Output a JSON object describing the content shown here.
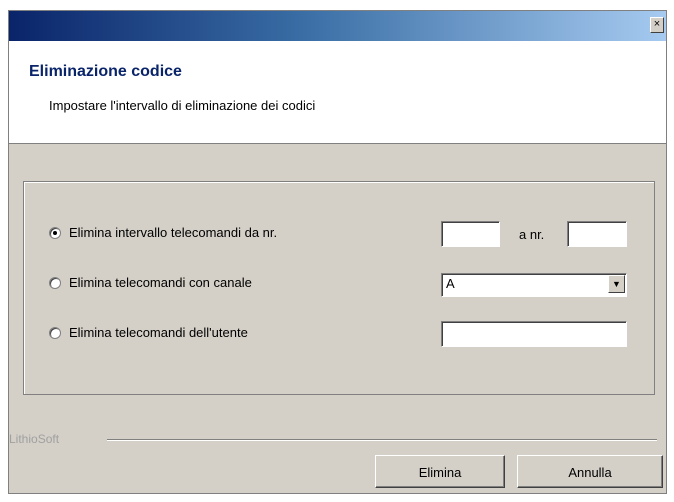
{
  "window": {
    "close_glyph": "×"
  },
  "header": {
    "title": "Eliminazione codice",
    "subtitle": "Impostare l'intervallo di eliminazione dei codici"
  },
  "options": {
    "range": {
      "label": "Elimina intervallo telecomandi da nr.",
      "checked": true,
      "from_value": "",
      "to_label": "a nr.",
      "to_value": ""
    },
    "channel": {
      "label": "Elimina telecomandi con canale",
      "checked": false,
      "selected_value": "A"
    },
    "user": {
      "label": "Elimina telecomandi dell'utente",
      "checked": false,
      "value": ""
    }
  },
  "footer": {
    "brand": "LithioSoft",
    "delete_label": "Elimina",
    "cancel_label": "Annulla"
  },
  "colors": {
    "title_blue": "#0a246a",
    "dialog_bg": "#d4d0c8"
  },
  "icons": {
    "close": "close-icon",
    "dropdown": "chevron-down-icon"
  }
}
